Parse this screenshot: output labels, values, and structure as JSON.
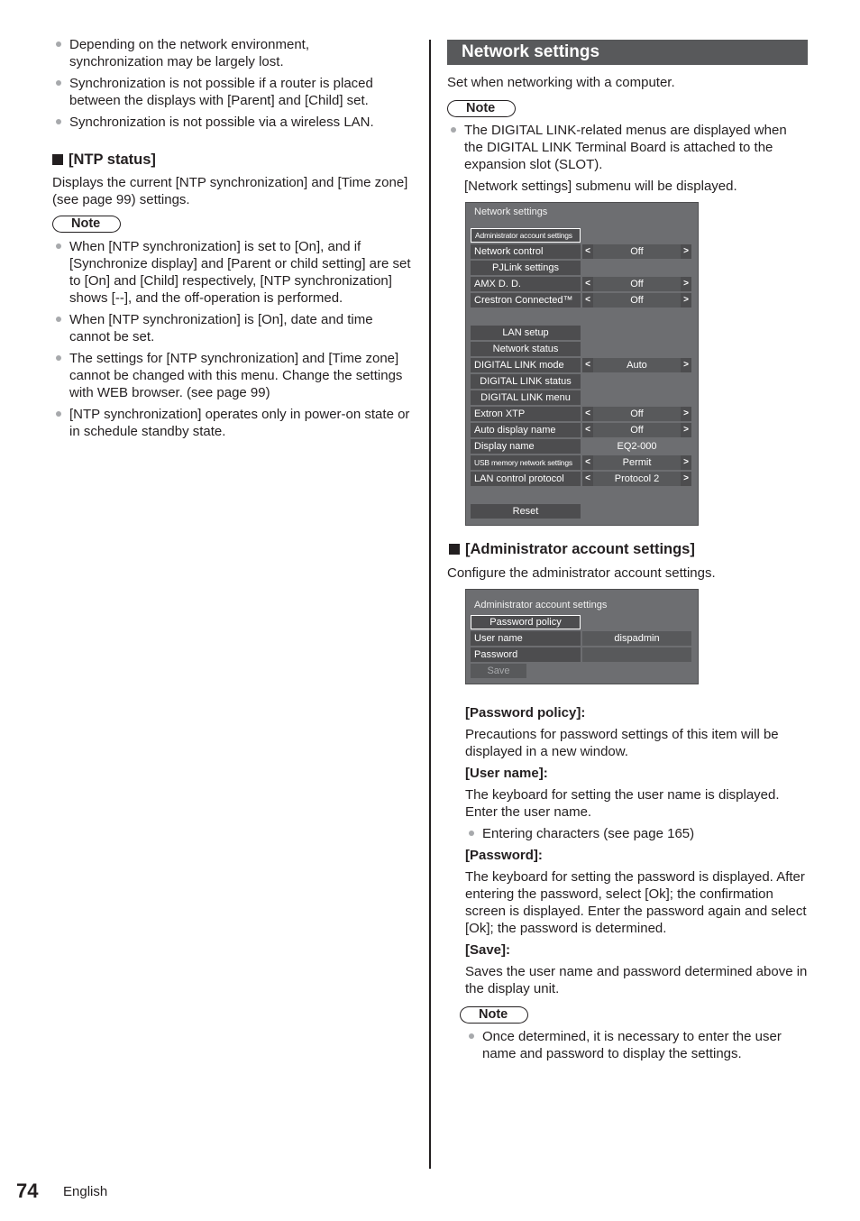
{
  "left_column": {
    "top_bullets": [
      "Depending on the network environment, synchronization may be largely lost.",
      "Synchronization is not possible if a router is placed between the displays with [Parent] and [Child] set.",
      "Synchronization is not possible via a wireless LAN."
    ],
    "ntp_status": {
      "heading": "[NTP status]",
      "description": "Displays the current [NTP synchronization] and [Time zone] (see page 99) settings.",
      "note_label": "Note",
      "notes": [
        "When [NTP synchronization] is set to [On], and if [Synchronize display] and [Parent or child setting] are set to [On] and [Child] respectively, [NTP synchronization] shows [--], and the off-operation is performed.",
        "When [NTP synchronization] is [On], date and time cannot be set.",
        "The settings for [NTP synchronization] and [Time zone] cannot be changed with this menu. Change the settings with WEB browser. (see page 99)",
        "[NTP synchronization] operates only in power-on state or in schedule standby state."
      ]
    }
  },
  "right_column": {
    "section_title": "Network settings",
    "intro": "Set when networking with a computer.",
    "note_label": "Note",
    "notes": [
      "The DIGITAL LINK-related menus are displayed when the DIGITAL LINK Terminal Board is attached to the expansion slot (SLOT)."
    ],
    "submenu_text": "[Network settings] submenu will be displayed.",
    "network_menu": {
      "title": "Network settings",
      "items": [
        {
          "label": "Administrator account settings",
          "type": "button",
          "selected": true
        },
        {
          "label": "Network control",
          "type": "select",
          "value": "Off"
        },
        {
          "label": "PJLink settings",
          "type": "button"
        },
        {
          "label": "AMX D. D.",
          "type": "select",
          "value": "Off"
        },
        {
          "label": "Crestron Connected™",
          "type": "select",
          "value": "Off"
        },
        {
          "label": "LAN setup",
          "type": "button"
        },
        {
          "label": "Network status",
          "type": "button"
        },
        {
          "label": "DIGITAL LINK mode",
          "type": "select",
          "value": "Auto"
        },
        {
          "label": "DIGITAL LINK status",
          "type": "button"
        },
        {
          "label": "DIGITAL LINK menu",
          "type": "button"
        },
        {
          "label": "Extron XTP",
          "type": "select",
          "value": "Off"
        },
        {
          "label": "Auto display name",
          "type": "select",
          "value": "Off"
        },
        {
          "label": "Display name",
          "type": "text",
          "value": "EQ2-000"
        },
        {
          "label": "USB memory network settings",
          "type": "select",
          "value": "Permit"
        },
        {
          "label": "LAN control protocol",
          "type": "select",
          "value": "Protocol 2"
        },
        {
          "label": "Reset",
          "type": "button"
        }
      ],
      "arrow_left": "<",
      "arrow_right": ">"
    },
    "admin_section": {
      "heading": "[Administrator account settings]",
      "description": "Configure the administrator account settings.",
      "admin_menu": {
        "title": "Administrator account settings",
        "password_policy": "Password policy",
        "user_name_label": "User name",
        "user_name_value": "dispadmin",
        "password_label": "Password",
        "password_value": "",
        "save_label": "Save"
      },
      "details": [
        {
          "term": "[Password policy]:",
          "text": "Precautions for password settings of this item will be displayed in a new window."
        },
        {
          "term": "[User name]:",
          "text": "The keyboard for setting the user name is displayed. Enter the user name.",
          "bullet": "Entering characters (see page 165)"
        },
        {
          "term": "[Password]:",
          "text": "The keyboard for setting the password is displayed. After entering the password, select [Ok]; the confirmation screen is displayed. Enter the password again and select [Ok]; the password is determined."
        },
        {
          "term": "[Save]:",
          "text": "Saves the user name and password determined above in the display unit."
        }
      ],
      "note_label": "Note",
      "notes": [
        "Once determined, it is necessary to enter the user name and password to display the settings."
      ]
    }
  },
  "footer": {
    "page_number": "74",
    "language": "English"
  }
}
